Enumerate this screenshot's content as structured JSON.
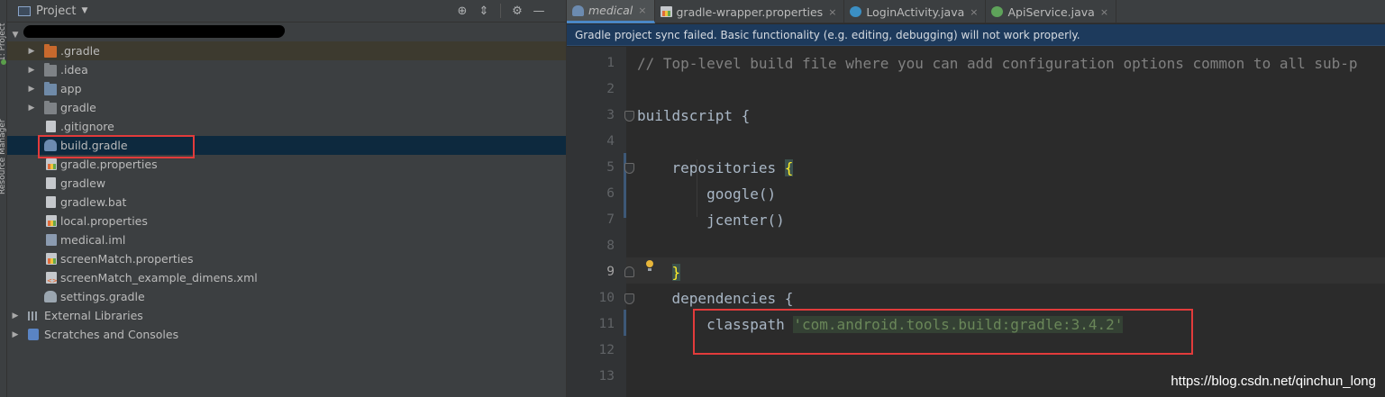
{
  "tool_strip": {
    "project_tab": "1: Project",
    "resource_tab": "Resource Manager"
  },
  "project_panel": {
    "title": "Project",
    "header_icons": [
      "locate-icon",
      "collapse-all-icon",
      "gear-icon",
      "hide-icon"
    ],
    "items": [
      {
        "label": ".gradle",
        "icon": "folder-orange",
        "expandable": true
      },
      {
        "label": ".idea",
        "icon": "folder",
        "expandable": true
      },
      {
        "label": "app",
        "icon": "folder-module",
        "expandable": true
      },
      {
        "label": "gradle",
        "icon": "folder",
        "expandable": true
      },
      {
        "label": ".gitignore",
        "icon": "file"
      },
      {
        "label": "build.gradle",
        "icon": "gradle-elephant",
        "selected": true
      },
      {
        "label": "gradle.properties",
        "icon": "properties-file"
      },
      {
        "label": "gradlew",
        "icon": "file"
      },
      {
        "label": "gradlew.bat",
        "icon": "file"
      },
      {
        "label": "local.properties",
        "icon": "properties-file"
      },
      {
        "label": "medical.iml",
        "icon": "iml-file"
      },
      {
        "label": "screenMatch.properties",
        "icon": "properties-file"
      },
      {
        "label": "screenMatch_example_dimens.xml",
        "icon": "xml-file"
      },
      {
        "label": "settings.gradle",
        "icon": "gradle-elephant"
      },
      {
        "label": "External Libraries",
        "icon": "libraries",
        "expandable": true
      },
      {
        "label": "Scratches and Consoles",
        "icon": "scratches",
        "expandable": true
      }
    ]
  },
  "editor": {
    "tabs": [
      {
        "label": "medical",
        "icon": "gradle-elephant",
        "active": true
      },
      {
        "label": "gradle-wrapper.properties",
        "icon": "properties-file"
      },
      {
        "label": "LoginActivity.java",
        "icon": "java-class"
      },
      {
        "label": "ApiService.java",
        "icon": "java-interface"
      }
    ],
    "banner": "Gradle project sync failed. Basic functionality (e.g. editing, debugging) will not work properly.",
    "current_line": "9",
    "lines": [
      {
        "n": "1",
        "parts": [
          {
            "t": "// Top-level build file where you can add configuration options common to all sub-p",
            "c": "comment"
          }
        ]
      },
      {
        "n": "2",
        "parts": []
      },
      {
        "n": "3",
        "parts": [
          {
            "t": "buildscript {",
            "c": ""
          }
        ]
      },
      {
        "n": "4",
        "parts": []
      },
      {
        "n": "5",
        "parts": [
          {
            "t": "    repositories ",
            "c": ""
          },
          {
            "t": "{",
            "c": "brace-hl"
          }
        ]
      },
      {
        "n": "6",
        "parts": [
          {
            "t": "        google()",
            "c": ""
          }
        ]
      },
      {
        "n": "7",
        "parts": [
          {
            "t": "        jcenter()",
            "c": ""
          }
        ]
      },
      {
        "n": "8",
        "parts": []
      },
      {
        "n": "9",
        "parts": [
          {
            "t": "    ",
            "c": ""
          },
          {
            "t": "}",
            "c": "brace-hl"
          }
        ]
      },
      {
        "n": "10",
        "parts": [
          {
            "t": "    dependencies {",
            "c": ""
          }
        ]
      },
      {
        "n": "11",
        "parts": [
          {
            "t": "        classpath ",
            "c": ""
          },
          {
            "t": "'com.android.tools.build:gradle:3.4.2'",
            "c": "str"
          }
        ]
      },
      {
        "n": "12",
        "parts": []
      },
      {
        "n": "13",
        "parts": []
      }
    ]
  },
  "watermark": "https://blog.csdn.net/qinchun_long"
}
